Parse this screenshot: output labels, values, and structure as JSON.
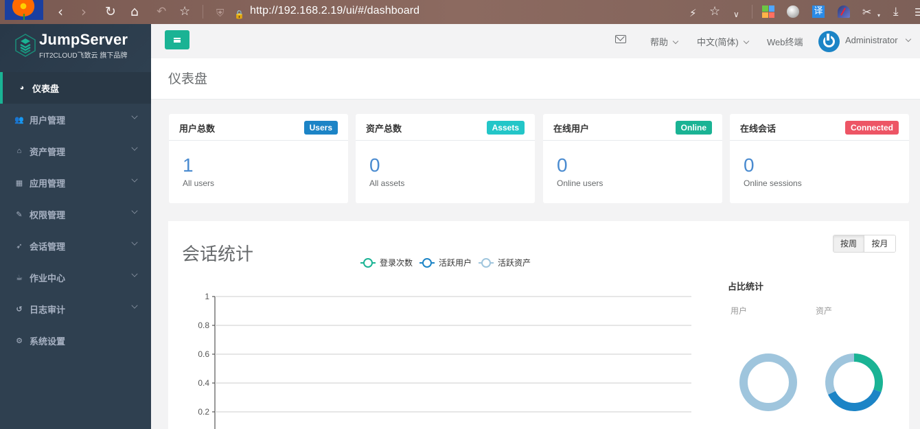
{
  "browser": {
    "url": "http://192.168.2.19/ui/#/dashboard",
    "icons": [
      "back-icon",
      "forward-icon",
      "reload-icon",
      "home-icon",
      "undo-icon",
      "bookmark-star-icon",
      "shield-icon",
      "insecure-lock-icon",
      "lightning-icon",
      "favorite-star-icon",
      "dropdown-chevron-icon",
      "apps-grid-icon",
      "globe-icon",
      "translate-icon",
      "speed-gauge-icon",
      "scissors-icon",
      "download-icon",
      "menu-icon"
    ],
    "translate_glyph": "译"
  },
  "sidebar": {
    "logo_title": "JumpServer",
    "logo_subtitle": "FIT2CLOUD飞致云 旗下品牌",
    "items": [
      {
        "label": "仪表盘",
        "icon": "dashboard-icon",
        "glyph": "◕",
        "active": true,
        "expandable": false
      },
      {
        "label": "用户管理",
        "icon": "users-icon",
        "glyph": "👥",
        "active": false,
        "expandable": true
      },
      {
        "label": "资产管理",
        "icon": "inbox-icon",
        "glyph": "⌂",
        "active": false,
        "expandable": true
      },
      {
        "label": "应用管理",
        "icon": "grid-icon",
        "glyph": "▦",
        "active": false,
        "expandable": true
      },
      {
        "label": "权限管理",
        "icon": "edit-icon",
        "glyph": "✎",
        "active": false,
        "expandable": true
      },
      {
        "label": "会话管理",
        "icon": "rocket-icon",
        "glyph": "➶",
        "active": false,
        "expandable": true
      },
      {
        "label": "作业中心",
        "icon": "coffee-icon",
        "glyph": "☕",
        "active": false,
        "expandable": true
      },
      {
        "label": "日志审计",
        "icon": "history-icon",
        "glyph": "↺",
        "active": false,
        "expandable": true
      },
      {
        "label": "系统设置",
        "icon": "gears-icon",
        "glyph": "⚙",
        "active": false,
        "expandable": false
      }
    ]
  },
  "topnav": {
    "help": "帮助",
    "language": "中文(简体)",
    "web_terminal": "Web终端",
    "user": "Administrator"
  },
  "page": {
    "title": "仪表盘"
  },
  "cards": [
    {
      "title": "用户总数",
      "badge": "Users",
      "badge_color": "#1c84c6",
      "value": "1",
      "label": "All users"
    },
    {
      "title": "资产总数",
      "badge": "Assets",
      "badge_color": "#23c6c8",
      "value": "0",
      "label": "All assets"
    },
    {
      "title": "在线用户",
      "badge": "Online",
      "badge_color": "#1ab394",
      "value": "0",
      "label": "Online users"
    },
    {
      "title": "在线会话",
      "badge": "Connected",
      "badge_color": "#ed5565",
      "value": "0",
      "label": "Online sessions"
    }
  ],
  "sessions": {
    "title": "会话统计",
    "period_buttons": [
      {
        "label": "按周",
        "active": true
      },
      {
        "label": "按月",
        "active": false
      }
    ],
    "ratio_title": "占比统计",
    "donut_labels": [
      "用户",
      "资产"
    ]
  },
  "chart_data": [
    {
      "type": "line",
      "title": "会话统计",
      "series": [
        {
          "name": "登录次数",
          "color": "#1ab394",
          "values": []
        },
        {
          "name": "活跃用户",
          "color": "#1c84c6",
          "values": []
        },
        {
          "name": "活跃资产",
          "color": "#9fc5dd",
          "values": []
        }
      ],
      "legend_position": "top",
      "ylim": [
        0,
        1
      ],
      "yticks": [
        "0.2",
        "0.4",
        "0.6",
        "0.8",
        "1"
      ],
      "grid": true,
      "xlabel": "",
      "ylabel": ""
    },
    {
      "type": "pie",
      "title": "用户",
      "donut": true,
      "slices": [
        {
          "name": "empty",
          "value": 1,
          "color": "#9fc5dd"
        }
      ]
    },
    {
      "type": "pie",
      "title": "资产",
      "donut": true,
      "slices": [
        {
          "name": "segment-1",
          "value": 0.305,
          "color": "#1ab394"
        },
        {
          "name": "segment-2",
          "value": 0.375,
          "color": "#1c84c6"
        },
        {
          "name": "segment-3",
          "value": 0.32,
          "color": "#9fc5dd"
        }
      ]
    }
  ]
}
